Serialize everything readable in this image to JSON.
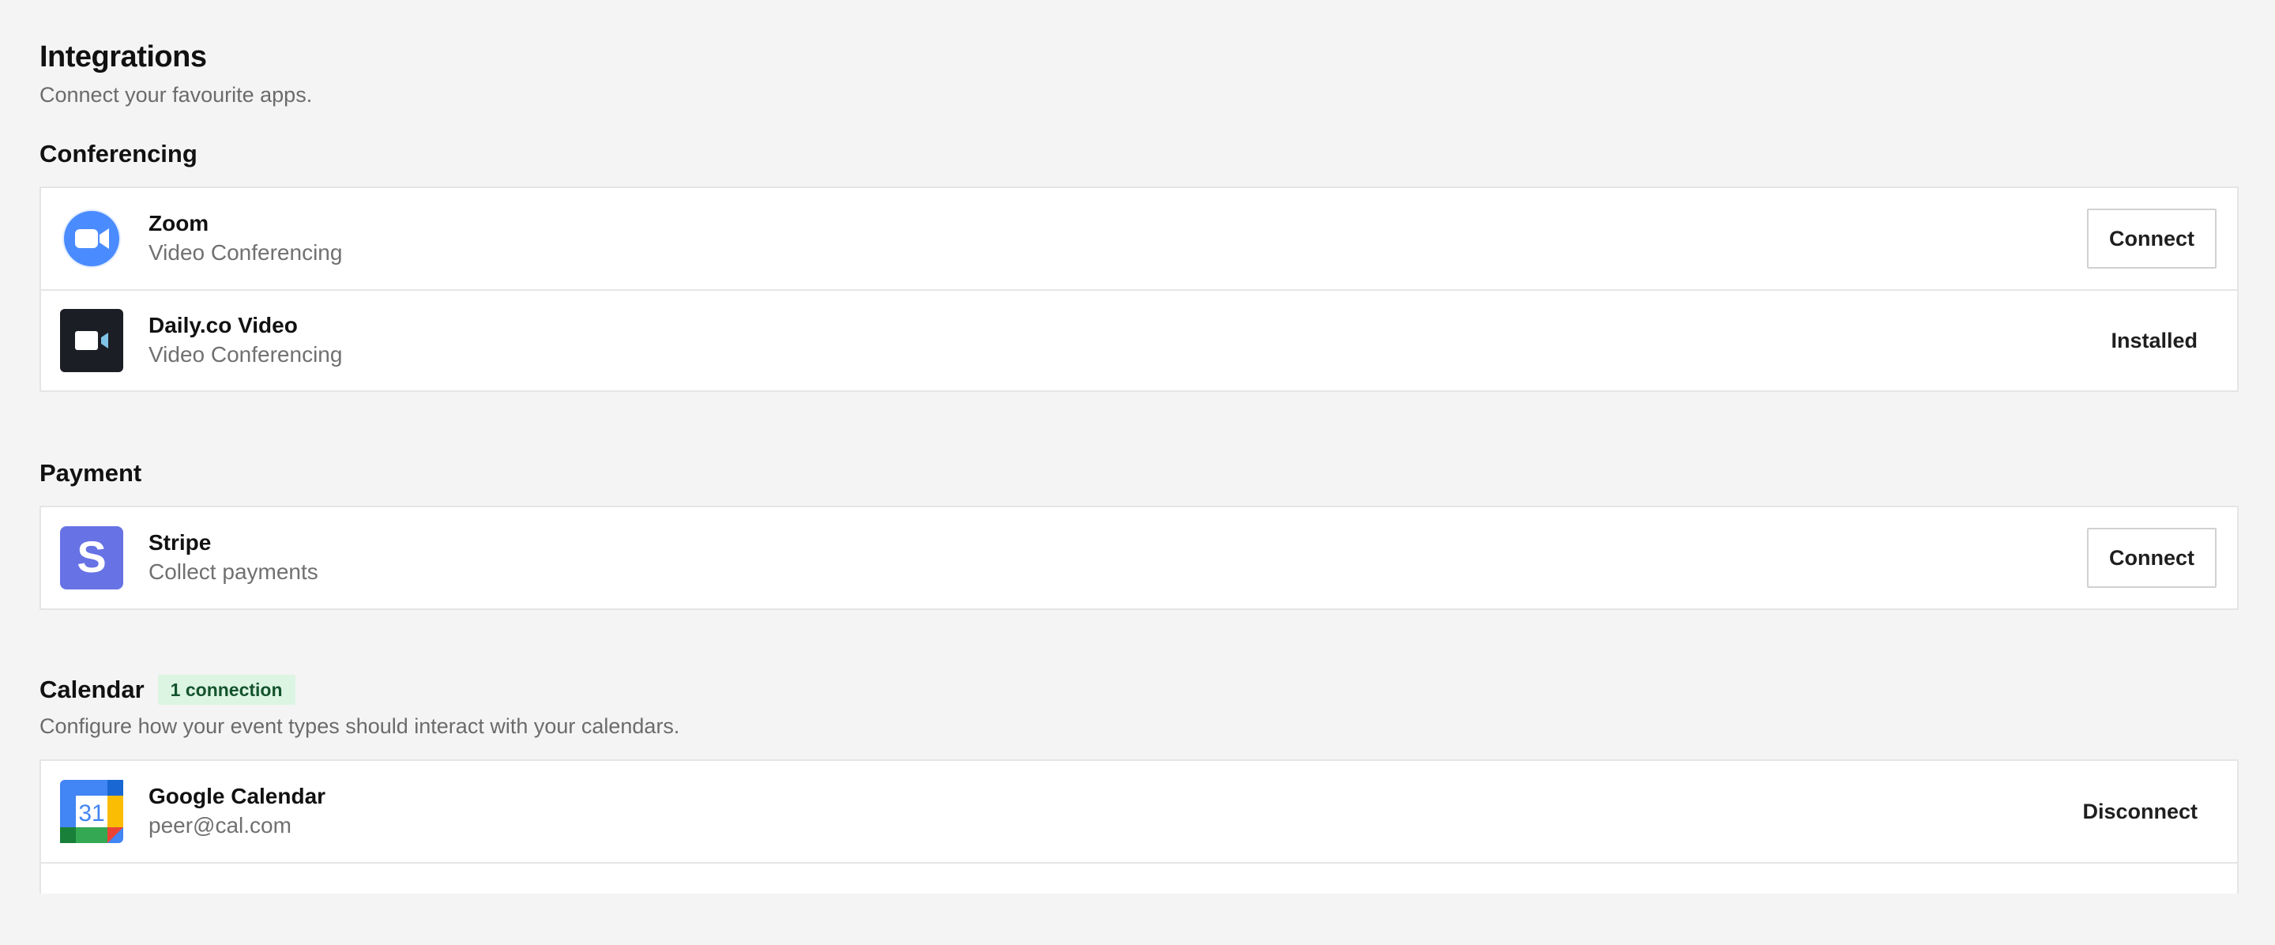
{
  "header": {
    "title": "Integrations",
    "subtitle": "Connect your favourite apps."
  },
  "sections": {
    "conferencing": {
      "title": "Conferencing",
      "apps": [
        {
          "name": "Zoom",
          "category": "Video Conferencing",
          "action": "Connect",
          "icon": "zoom-icon"
        },
        {
          "name": "Daily.co Video",
          "category": "Video Conferencing",
          "status": "Installed",
          "icon": "daily-video-icon"
        }
      ]
    },
    "payment": {
      "title": "Payment",
      "apps": [
        {
          "name": "Stripe",
          "category": "Collect payments",
          "action": "Connect",
          "icon": "stripe-icon",
          "logo_letter": "S"
        }
      ]
    },
    "calendar": {
      "title": "Calendar",
      "badge": "1 connection",
      "description": "Configure how your event types should interact with your calendars.",
      "apps": [
        {
          "name": "Google Calendar",
          "account": "peer@cal.com",
          "action": "Disconnect",
          "icon": "google-calendar-icon",
          "logo_text": "31"
        }
      ]
    }
  },
  "colors": {
    "background": "#f4f4f4",
    "zoom_blue": "#4a8cff",
    "daily_dark": "#1b1e24",
    "stripe_purple": "#6772e5",
    "badge_bg": "#dcf5e3",
    "badge_text": "#14532d"
  }
}
